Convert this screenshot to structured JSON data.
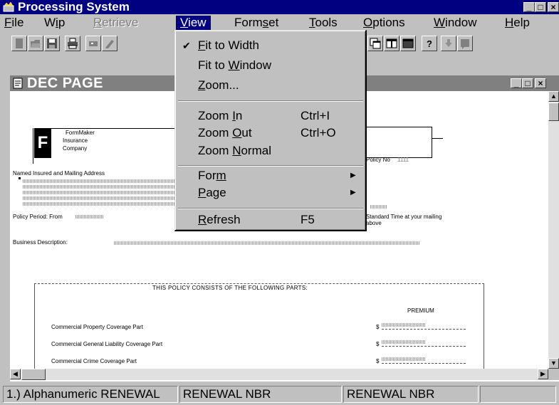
{
  "app": {
    "title": "Processing System"
  },
  "menubar": {
    "items": [
      {
        "id": "file",
        "label": "File",
        "underline": "F",
        "rest": "ile"
      },
      {
        "id": "wip",
        "label": "Wip",
        "pre": "W",
        "underline": "i",
        "rest": "p"
      },
      {
        "id": "retrieve",
        "label": "Retrieve",
        "underline": "R",
        "rest": "etrieve",
        "disabled": true
      },
      {
        "id": "view",
        "label": "View",
        "underline": "V",
        "rest": "iew",
        "active": true
      },
      {
        "id": "formset",
        "label": "Formset",
        "pre": "Form",
        "underline": "s",
        "rest": "et"
      },
      {
        "id": "tools",
        "label": "Tools",
        "underline": "T",
        "rest": "ools"
      },
      {
        "id": "options",
        "label": "Options",
        "underline": "O",
        "rest": "ptions"
      },
      {
        "id": "window",
        "label": "Window",
        "underline": "W",
        "rest": "indow"
      },
      {
        "id": "help",
        "label": "Help",
        "underline": "H",
        "rest": "elp"
      }
    ]
  },
  "view_menu": {
    "fit_to_width": {
      "pre": "",
      "u": "F",
      "post": "it to Width",
      "checked": true
    },
    "fit_to_window": {
      "pre": "Fit to ",
      "u": "W",
      "post": "indow"
    },
    "zoom": {
      "pre": "",
      "u": "Z",
      "post": "oom..."
    },
    "zoom_in": {
      "pre": "Zoom ",
      "u": "I",
      "post": "n",
      "accel": "Ctrl+I"
    },
    "zoom_out": {
      "pre": "Zoom ",
      "u": "O",
      "post": "ut",
      "accel": "Ctrl+O"
    },
    "zoom_normal": {
      "pre": "Zoom ",
      "u": "N",
      "post": "ormal"
    },
    "form": {
      "pre": "For",
      "u": "m",
      "post": ""
    },
    "page": {
      "pre": "",
      "u": "P",
      "post": "age"
    },
    "refresh": {
      "pre": "",
      "u": "R",
      "post": "efresh",
      "accel": "F5"
    }
  },
  "child_window": {
    "title": "DEC PAGE"
  },
  "document": {
    "logo_letter": "F",
    "company_lines": [
      "FormMaker",
      "Insurance",
      "Company"
    ],
    "named_insured": "Named Insured and Mailing Address",
    "policy_no": "Policy No",
    "policy_no_value": "1111",
    "policy_period": "Policy Period:  From",
    "standard_time": "Standard Time at your mailing",
    "above": "above",
    "business": "Business Description:",
    "parts_heading": "THIS POLICY CONSISTS OF THE FOLLOWING PARTS:",
    "premium": "PREMIUM",
    "parts": [
      {
        "label": "Commercial Property Coverage Part",
        "currency": "$"
      },
      {
        "label": "Commercial General Liability Coverage Part",
        "currency": "$"
      },
      {
        "label": "Commercial Crime Coverage Part",
        "currency": "$"
      }
    ]
  },
  "statusbar": {
    "cells": [
      "1.) Alphanumeric RENEWAL",
      "RENEWAL NBR",
      "RENEWAL NBR",
      ""
    ]
  }
}
